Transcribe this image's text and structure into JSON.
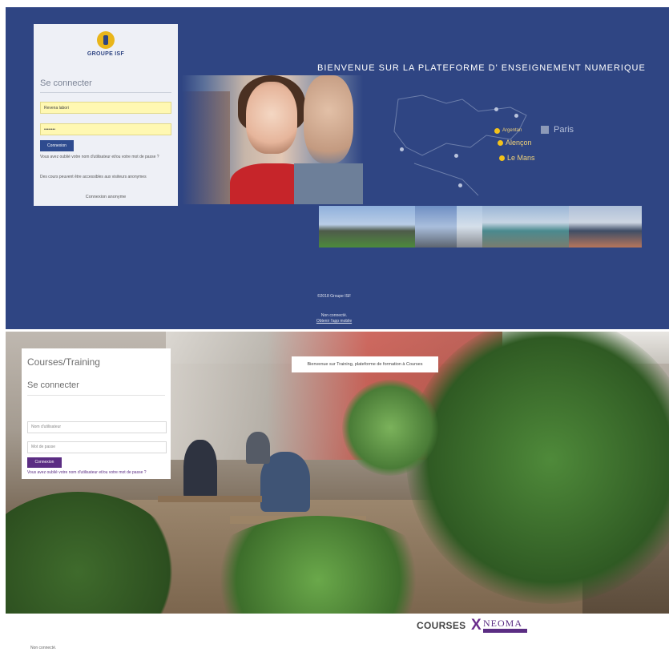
{
  "top": {
    "logo_text": "GROUPE ISF",
    "login": {
      "title": "Se connecter",
      "username_value": "Revena labori",
      "password_value": "••••••••",
      "submit_label": "Connexion",
      "forgot_text": "Vous avez oublié votre nom d'utilisateur et/ou votre mot de passe ?",
      "guest_info": "Des cours peuvent être accessibles aux visiteurs anonymes",
      "guest_login": "Connexion anonyme"
    },
    "welcome": "BIENVENUE SUR LA PLATEFORME D' ENSEIGNEMENT NUMERIQUE",
    "map": {
      "cities": [
        "Argentan",
        "Alençon",
        "Le Mans",
        "Paris"
      ]
    },
    "footer": {
      "copyright": "©2018 Groupe ISF",
      "not_connected": "Non connecté.",
      "mobile_app": "Obtenir l'app mobile"
    }
  },
  "bottom": {
    "login": {
      "title": "Courses/Training",
      "subtitle": "Se connecter",
      "username_placeholder": "Nom d'utilisateur",
      "password_placeholder": "Mot de passe",
      "submit_label": "Connexion",
      "forgot_text": "Vous avez oublié votre nom d'utilisateur et/ou votre mot de passe ?"
    },
    "welcome": "Bienvenue sur Training, plateforme de formation à Courses",
    "footer": {
      "logo_courses": "COURSES",
      "logo_x": "X",
      "logo_neoma": "NEOMA",
      "not_connected": "Non connecté."
    }
  },
  "colors": {
    "top_background": "#2f4583",
    "isf_yellow": "#e9b51a",
    "neoma_purple": "#5b2d83",
    "top_button": "#2e4b8f",
    "autofill_yellow": "#fff8b2"
  },
  "icons": [
    "isf-sun-logo-icon",
    "map-city-marker-icon"
  ]
}
